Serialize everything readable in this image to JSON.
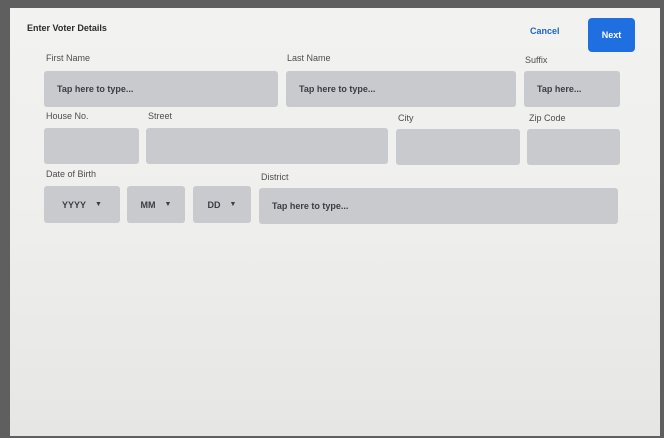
{
  "header": {
    "title": "Enter Voter Details",
    "cancel_label": "Cancel",
    "next_label": "Next"
  },
  "form": {
    "first_name": {
      "label": "First Name",
      "placeholder": "Tap here to type..."
    },
    "last_name": {
      "label": "Last Name",
      "placeholder": "Tap here to type..."
    },
    "suffix": {
      "label": "Suffix",
      "placeholder": "Tap here..."
    },
    "house_no": {
      "label": "House No.",
      "placeholder": ""
    },
    "street": {
      "label": "Street",
      "placeholder": ""
    },
    "city": {
      "label": "City",
      "placeholder": ""
    },
    "zip_code": {
      "label": "Zip Code",
      "placeholder": ""
    },
    "date_of_birth": {
      "label": "Date of Birth",
      "year": "YYYY",
      "month": "MM",
      "day": "DD"
    },
    "district": {
      "label": "District",
      "placeholder": "Tap here to type..."
    }
  },
  "colors": {
    "accent": "#1f6fe0",
    "field_bg": "#c9cacd"
  },
  "icons": {
    "dropdown": "caret-down-icon"
  }
}
